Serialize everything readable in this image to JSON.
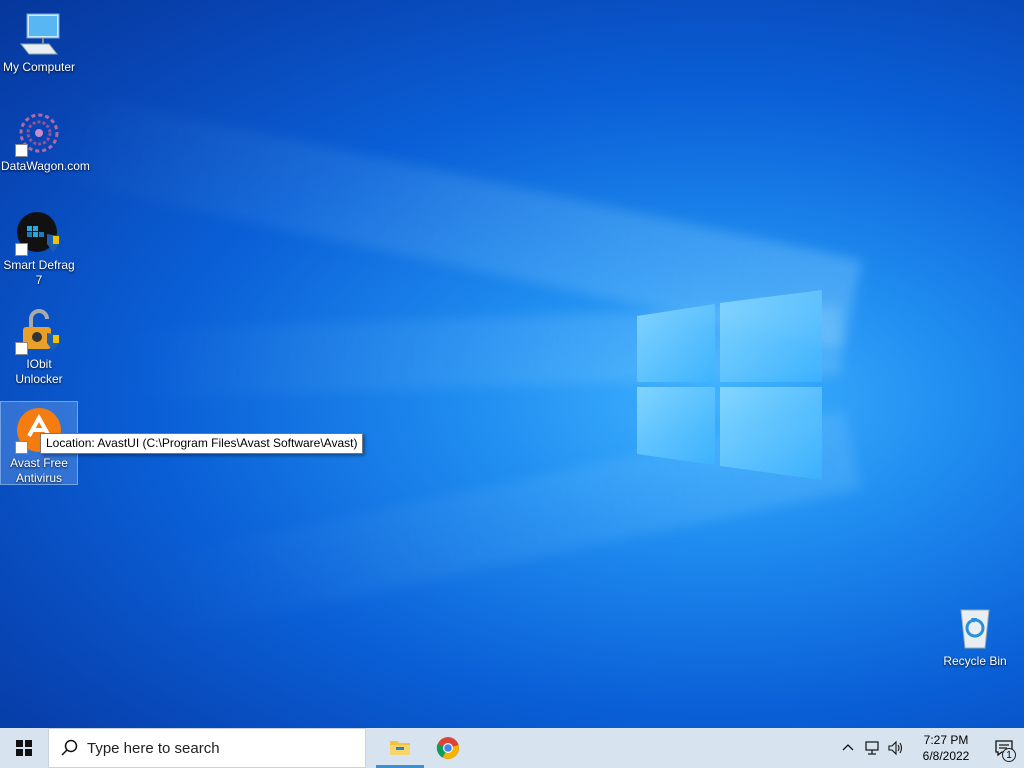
{
  "desktop": {
    "icons": [
      {
        "label": "My Computer",
        "icon": "computer-icon"
      },
      {
        "label": "DataWagon.com",
        "icon": "datawagon-icon"
      },
      {
        "label": "Smart Defrag 7",
        "icon": "smart-defrag-icon"
      },
      {
        "label": "IObit Unlocker",
        "icon": "iobit-unlocker-icon"
      },
      {
        "label": "Avast Free Antivirus",
        "icon": "avast-icon"
      },
      {
        "label": "Recycle Bin",
        "icon": "recycle-bin-icon"
      }
    ],
    "tooltip": "Location: AvastUI (C:\\Program Files\\Avast Software\\Avast)"
  },
  "taskbar": {
    "search_placeholder": "Type here to search",
    "pinned": [
      {
        "name": "File Explorer",
        "icon": "folder-icon"
      },
      {
        "name": "Google Chrome",
        "icon": "chrome-icon"
      }
    ],
    "clock": {
      "time": "7:27 PM",
      "date": "6/8/2022"
    },
    "notification_count": "1"
  },
  "colors": {
    "taskbar_bg": "#d7e4ef",
    "desktop_blue": "#0a5fd6",
    "avast_orange": "#f57c10"
  }
}
